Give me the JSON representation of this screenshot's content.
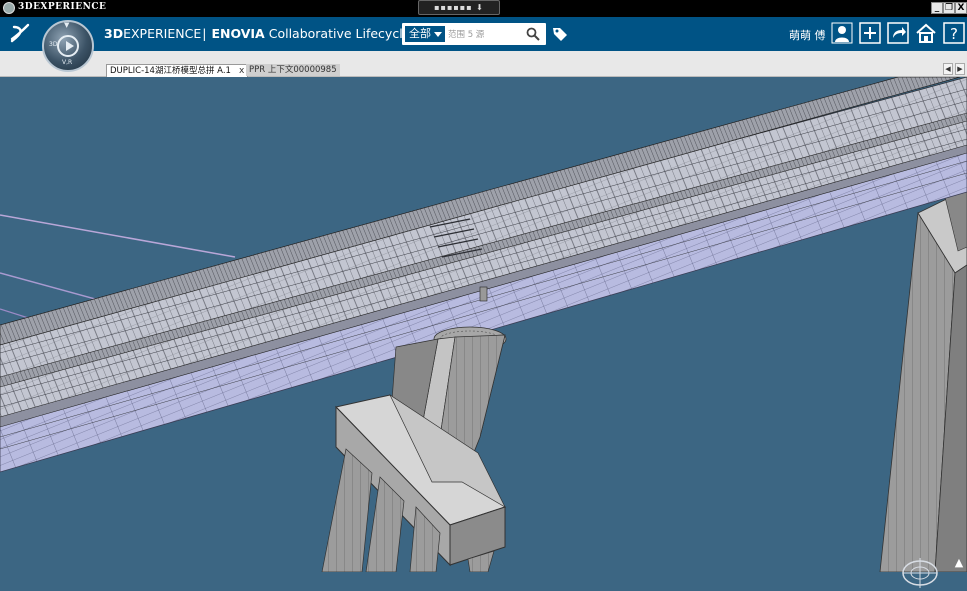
{
  "window": {
    "title": "3DEXPERIENCE",
    "center_handle": "▪▪▪▪▪▪ ⬇ ▪▪▪▪▪▪",
    "buttons": {
      "minimize": "_",
      "restore": "❐",
      "close": "X"
    }
  },
  "header": {
    "brand_3d": "3D",
    "brand_experience": "EXPERIENCE",
    "separator": "|",
    "brand_enovia": "ENOVIA",
    "app_title": "Collaborative Lifecycle Ma...",
    "compass_label": "V,R",
    "compass_left": "3D"
  },
  "search": {
    "scope": "全部",
    "placeholder": "范围 5 源"
  },
  "user": {
    "name": "萌萌 傅"
  },
  "tabs": [
    {
      "label": "DUPLIC-14湖江桥模型总拼 A.1",
      "active": true,
      "close": "x"
    },
    {
      "label": "PPR 上下文00000985",
      "active": false
    }
  ],
  "nav": {
    "prev": "◀",
    "next": "▶"
  },
  "icons": {
    "header": [
      "3ds-logo",
      "compass-icon",
      "search-icon",
      "tag-icon",
      "user-profile-icon",
      "add-icon",
      "share-icon",
      "home-icon",
      "help-icon"
    ],
    "viewport": [
      "view-compass-icon",
      "scroll-up-icon"
    ]
  },
  "colors": {
    "topbar": "#005385",
    "viewport_bg": "#3c6683",
    "tabbar": "#e8e8e8",
    "deck": "#c3c6d1",
    "girder": "#b8bbe0",
    "pier": "#9a9a9a"
  }
}
